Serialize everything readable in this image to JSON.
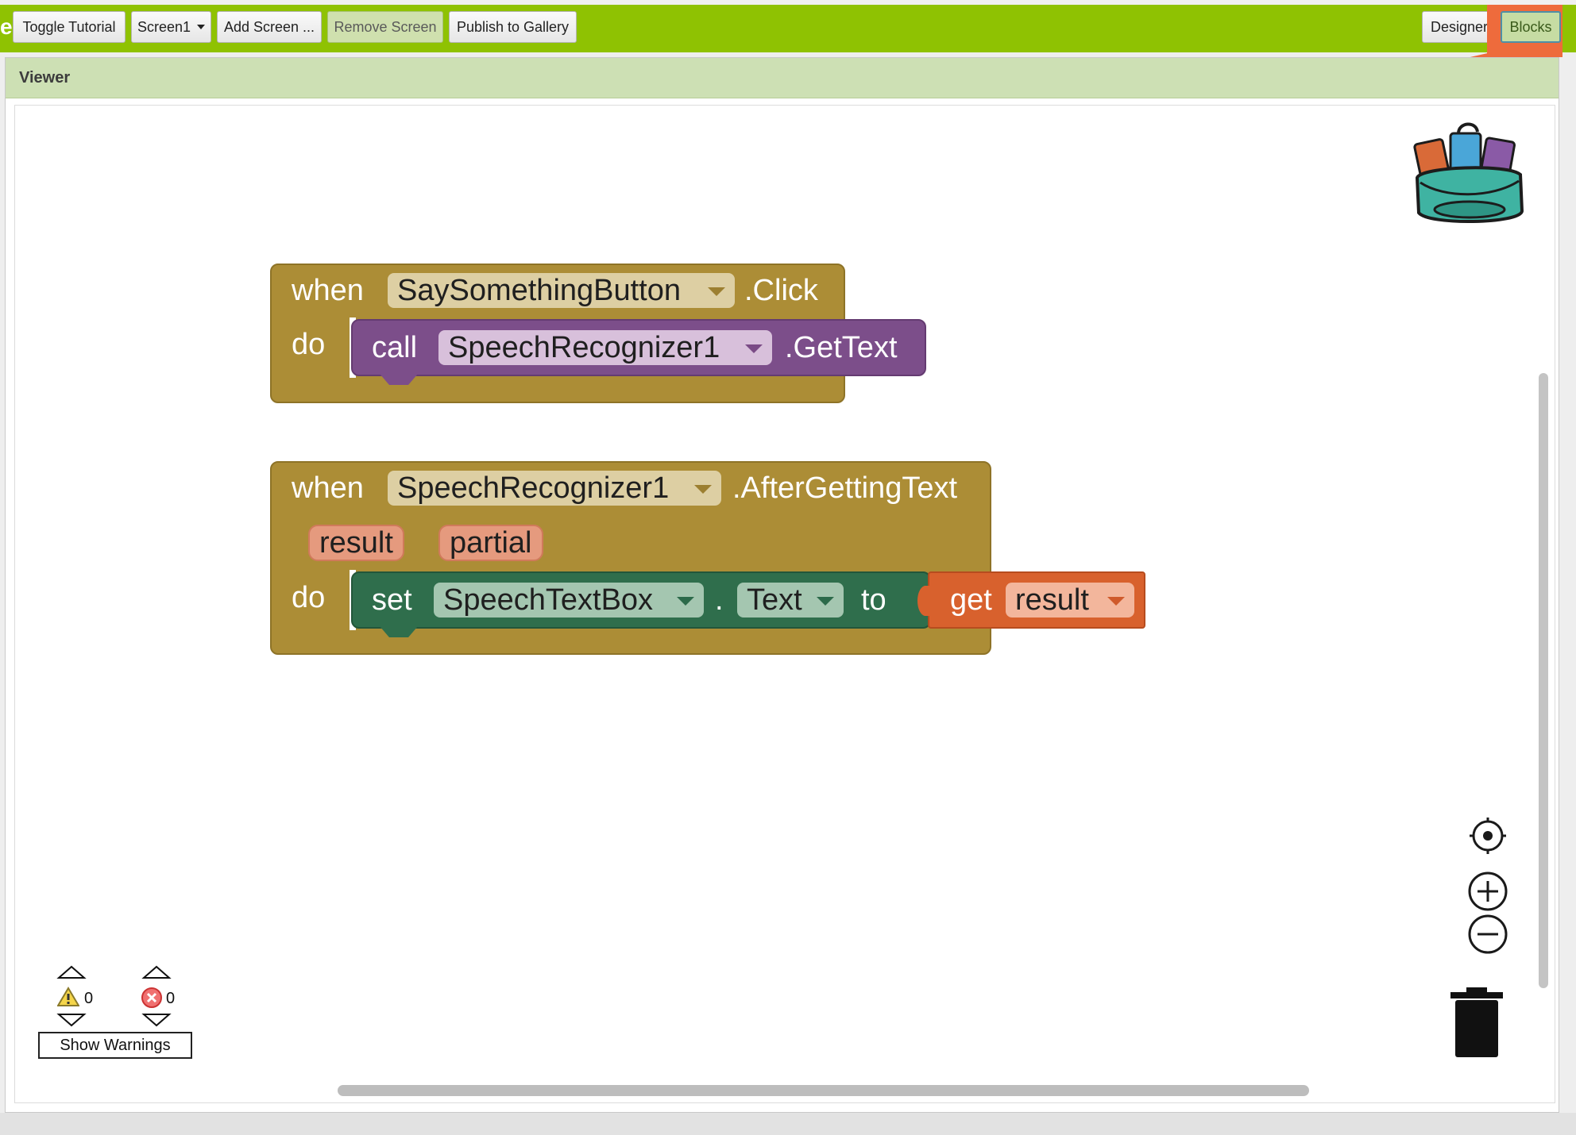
{
  "toolbar": {
    "edge_letter": "e",
    "toggle_tutorial": "Toggle Tutorial",
    "screen_select": "Screen1",
    "add_screen": "Add Screen ...",
    "remove_screen": "Remove Screen",
    "publish_gallery": "Publish to Gallery",
    "designer": "Designer",
    "blocks": "Blocks"
  },
  "viewer": {
    "title": "Viewer"
  },
  "blocks": {
    "event1": {
      "when": "when",
      "component": "SaySomethingButton",
      "event": ".Click",
      "do": "do",
      "call": {
        "call": "call",
        "component": "SpeechRecognizer1",
        "method": ".GetText"
      }
    },
    "event2": {
      "when": "when",
      "component": "SpeechRecognizer1",
      "event": ".AfterGettingText",
      "param1": "result",
      "param2": "partial",
      "do": "do",
      "setter": {
        "set": "set",
        "component": "SpeechTextBox",
        "dot": ".",
        "property": "Text",
        "to": "to"
      },
      "getter": {
        "get": "get",
        "variable": "result"
      }
    }
  },
  "warnings": {
    "warning_count": "0",
    "error_count": "0",
    "show_warnings": "Show Warnings"
  },
  "colors": {
    "toolbar_green": "#8fc202",
    "highlight_orange": "#ee6b3c",
    "event_block": "#ac8d36",
    "procedure_purple": "#7c4e8a",
    "setter_green": "#2f6e4c",
    "getter_orange": "#d8612d"
  }
}
